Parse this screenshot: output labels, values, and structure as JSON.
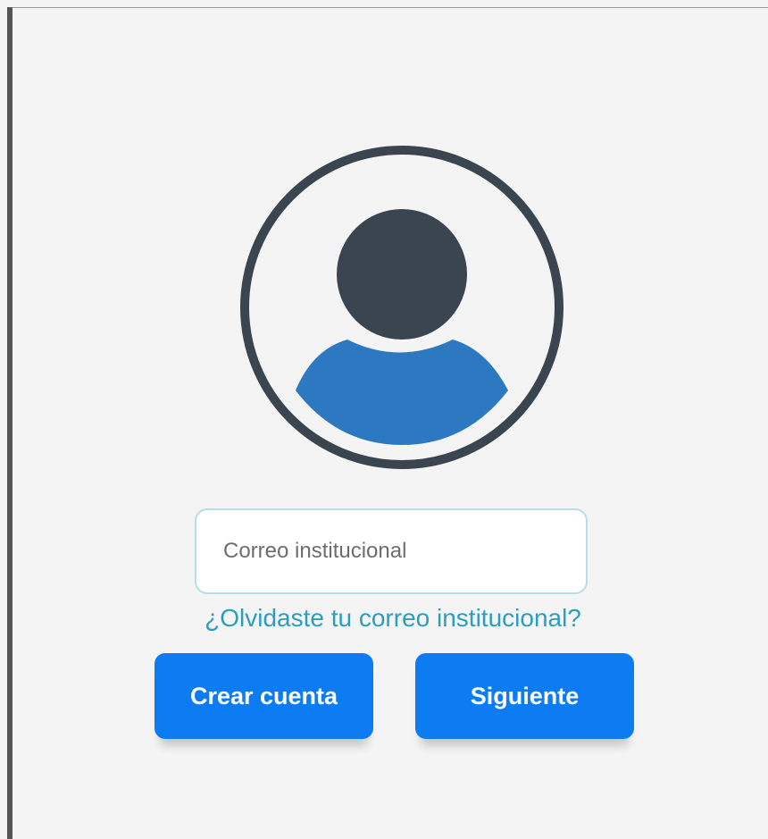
{
  "login": {
    "email_placeholder": "Correo institucional",
    "email_value": "",
    "forgot_link": "¿Olvidaste tu correo institucional?",
    "create_account_label": "Crear cuenta",
    "next_label": "Siguiente"
  },
  "icons": {
    "avatar": "user-avatar-icon"
  },
  "colors": {
    "background": "#f4f4f4",
    "avatar_dark": "#3b4550",
    "avatar_body": "#2c79c1",
    "primary_button": "#0d7cf2",
    "link": "#2a9fbd",
    "field_border": "#b7dfe3"
  }
}
